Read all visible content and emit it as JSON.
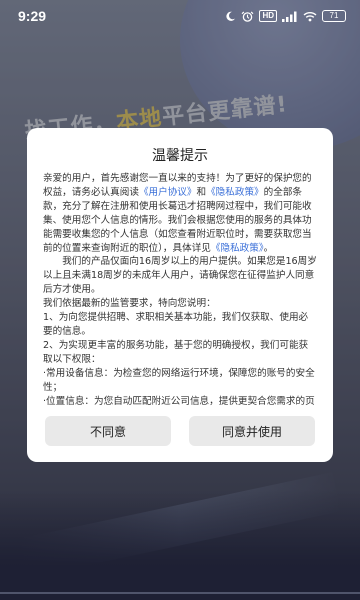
{
  "status_bar": {
    "time": "9:29",
    "icons": [
      "moon-icon",
      "alarm-icon",
      "hd-badge",
      "signal-icon",
      "wifi-icon",
      "battery-icon"
    ],
    "hd_label": "HD",
    "battery_level": "71"
  },
  "background": {
    "slogan_prefix": "找工作，",
    "slogan_accent": "本地",
    "slogan_suffix": "平台更靠谱!"
  },
  "dialog": {
    "title": "温馨提示",
    "p1_a": "亲爱的用户，首先感谢您一直以来的支持！为了更好的保护您的权益，请务必认真阅读",
    "user_agreement_link": "《用户协议》",
    "p1_and": "和",
    "privacy_link": "《隐私政策》",
    "p1_b": "的全部条款，充分了解在注册和使用长葛迅才招聘网过程中，我们可能收集、使用您个人信息的情形。我们会根据您使用的服务的具体功能需要收集您的个人信息（如您查看附近职位时，需要获取您当前的位置来查询附近的职位），具体详见",
    "privacy_link_2": "《隐私政策》",
    "p1_end": "。",
    "p2": "我们的产品仅面向16周岁以上的用户提供。如果您是16周岁以上且未满18周岁的未成年人用户，请确保您在征得监护人同意后方才使用。",
    "p3": "我们依据最新的监管要求，特向您说明：",
    "p4": "1、为向您提供招聘、求职相关基本功能，我们仅获取、使用必要的信息。",
    "p5": "2、为实现更丰富的服务功能，基于您的明确授权，我们可能获取以下权限：",
    "p6": "·常用设备信息：为检查您的网络运行环境，保障您的账号的安全性；",
    "p7": "·位置信息：为您自动匹配附近公司信息，提供更契合您需求的页面展示；",
    "disagree_label": "不同意",
    "agree_label": "同意并使用"
  },
  "colors": {
    "link": "#3a6fd8",
    "button_bg": "#e9e9e9",
    "slogan_accent": "#d8c36a"
  }
}
